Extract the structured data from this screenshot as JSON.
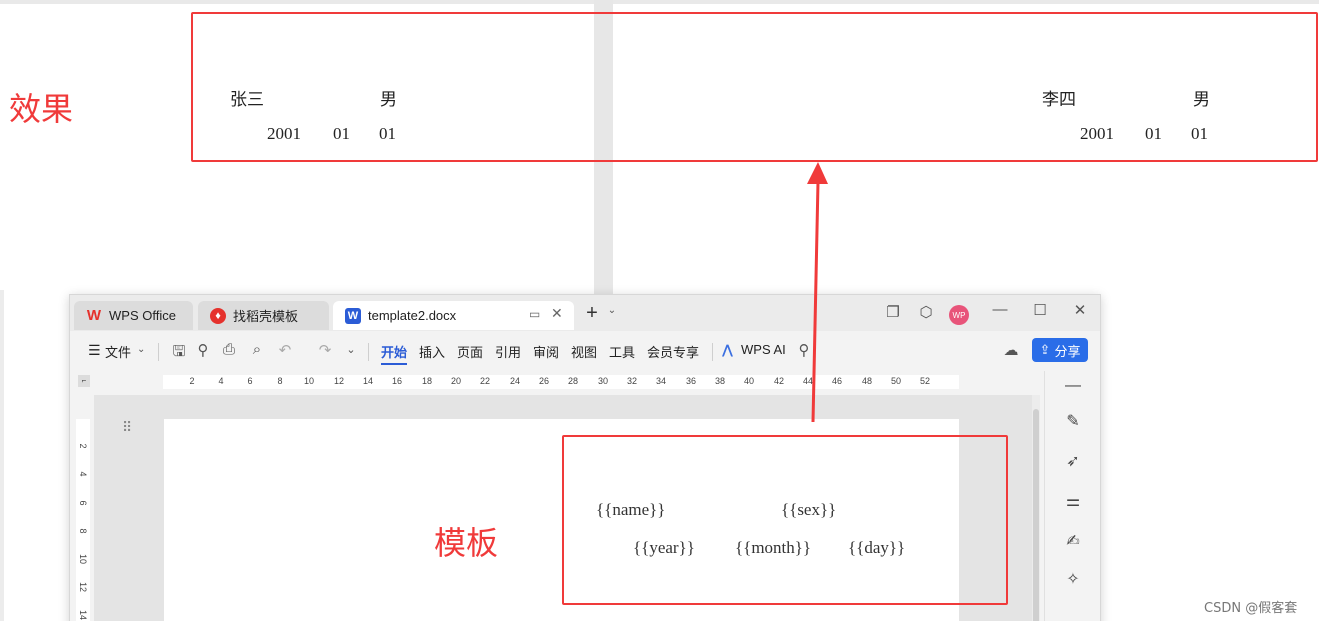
{
  "effect": {
    "label": "效果",
    "left": {
      "name": "张三",
      "sex": "男",
      "year": "2001",
      "month": "01",
      "day": "01"
    },
    "right": {
      "name": "李四",
      "sex": "男",
      "year": "2001",
      "month": "01",
      "day": "01"
    }
  },
  "template_label": "模板",
  "wps": {
    "tabs": [
      {
        "label": "WPS Office",
        "icon": "wps-logo-icon"
      },
      {
        "label": "找稻壳模板",
        "icon": "docer-icon"
      },
      {
        "label": "template2.docx",
        "icon": "word-doc-icon",
        "icon_text": "W"
      }
    ],
    "avatar_text": "WP",
    "toolbar": {
      "file_menu": "文件",
      "tabs": [
        "开始",
        "插入",
        "页面",
        "引用",
        "审阅",
        "视图",
        "工具",
        "会员专享"
      ],
      "active_tab": "开始",
      "wps_ai": "WPS AI",
      "share": "分享"
    },
    "ruler_ticks": [
      "2",
      "4",
      "6",
      "8",
      "10",
      "12",
      "14",
      "16",
      "18",
      "20",
      "22",
      "24",
      "26",
      "28",
      "30",
      "32",
      "34",
      "36",
      "38",
      "40",
      "42",
      "44",
      "46",
      "48",
      "50",
      "52"
    ],
    "vruler_ticks": [
      "2",
      "4",
      "6",
      "8",
      "10",
      "12",
      "14"
    ],
    "template": {
      "name": "{{name}}",
      "sex": "{{sex}}",
      "year": "{{year}}",
      "month": "{{month}}",
      "day": "{{day}}"
    }
  },
  "colors": {
    "annotation_red": "#f03a3a",
    "accent_blue": "#2b5cd6",
    "share_blue": "#2a6de8"
  },
  "watermark": "CSDN @假客套"
}
